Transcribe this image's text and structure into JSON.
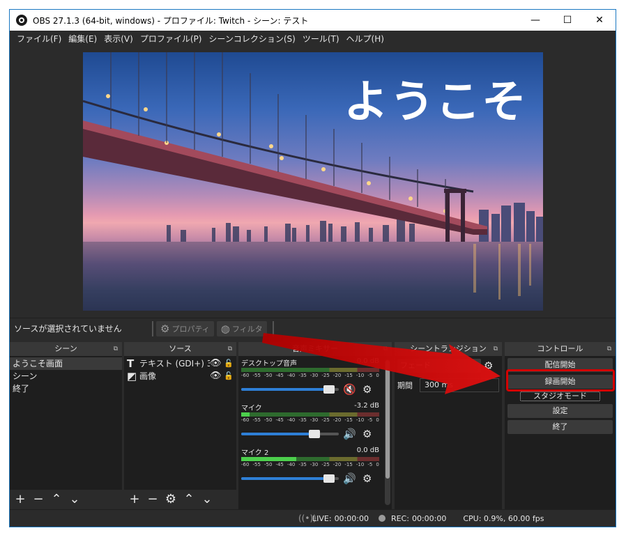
{
  "window": {
    "title": "OBS 27.1.3 (64-bit, windows) - プロファイル: Twitch - シーン: テスト",
    "minimize_label": "—",
    "maximize_label": "☐",
    "close_label": "✕"
  },
  "menu": [
    "ファイル(F)",
    "編集(E)",
    "表示(V)",
    "プロファイル(P)",
    "シーンコレクション(S)",
    "ツール(T)",
    "ヘルプ(H)"
  ],
  "preview": {
    "overlay_text": "ようこそ"
  },
  "source_toolbar": {
    "no_source_text": "ソースが選択されていません",
    "properties_label": "プロパティ",
    "filters_label": "フィルタ"
  },
  "docks": {
    "scenes": {
      "title": "シーン",
      "items": [
        "ようこそ画面",
        "シーン",
        "終了"
      ],
      "selected_index": 0
    },
    "sources": {
      "title": "ソース",
      "items": [
        {
          "label": "テキスト (GDI+) 3",
          "type_icon": "text-icon"
        },
        {
          "label": "画像",
          "type_icon": "image-icon"
        }
      ]
    },
    "mixer": {
      "title": "音声ミキサー",
      "channels": [
        {
          "name": "デスクトップ音声",
          "db": "0.0 dB",
          "level": 0,
          "volume": 0.9,
          "muted": true
        },
        {
          "name": "マイク",
          "db": "-3.2 dB",
          "level": 0.06,
          "volume": 0.75,
          "muted": false
        },
        {
          "name": "マイク 2",
          "db": "0.0 dB",
          "level": 0.4,
          "volume": 0.9,
          "muted": false
        }
      ],
      "ticks": [
        "-60",
        "-55",
        "-50",
        "-45",
        "-40",
        "-35",
        "-30",
        "-25",
        "-20",
        "-15",
        "-10",
        "-5",
        "0"
      ]
    },
    "transitions": {
      "title": "シーントランジション",
      "selected": "フェード",
      "duration_label": "期間",
      "duration_value": "300 ms"
    },
    "controls": {
      "title": "コントロール",
      "start_streaming": "配信開始",
      "start_recording": "録画開始",
      "studio_mode": "スタジオモード",
      "settings": "設定",
      "exit": "終了"
    }
  },
  "status": {
    "live_label": "LIVE:",
    "live_time": "00:00:00",
    "rec_label": "REC:",
    "rec_time": "00:00:00",
    "cpu": "CPU: 0.9%, 60.00 fps"
  },
  "colors": {
    "accent": "#1a78c2",
    "highlight": "#d40000",
    "meter_green": "#4ccf4c",
    "fader_blue": "#2e7fd6"
  }
}
